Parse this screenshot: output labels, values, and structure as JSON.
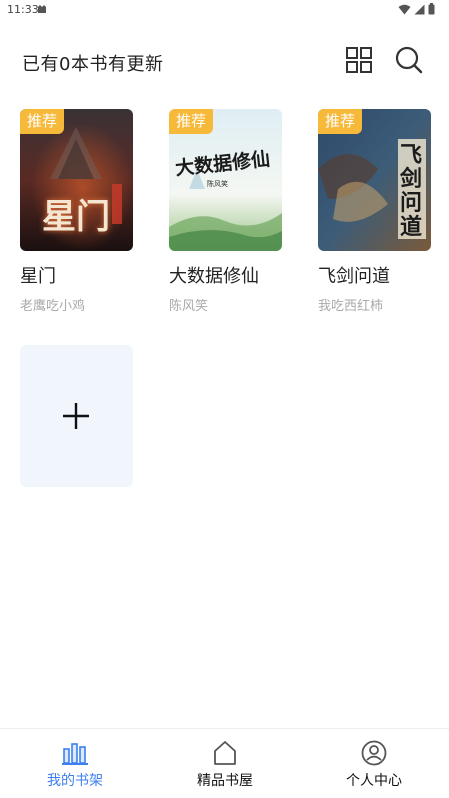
{
  "status_bar": {
    "time": "11:33"
  },
  "header": {
    "title": "已有0本书有更新"
  },
  "books": [
    {
      "title": "星门",
      "author": "老鹰吃小鸡",
      "badge": "推荐",
      "cover_text": "星门"
    },
    {
      "title": "大数据修仙",
      "author": "陈风笑",
      "badge": "推荐",
      "cover_text": "大数据修仙"
    },
    {
      "title": "飞剑问道",
      "author": "我吃西红柿",
      "badge": "推荐",
      "cover_text": "飞剑问道"
    }
  ],
  "add_card": {
    "icon": "plus-icon"
  },
  "bottom_nav": {
    "items": [
      {
        "label": "我的书架",
        "icon": "bookshelf-icon",
        "active": true
      },
      {
        "label": "精品书屋",
        "icon": "home-icon",
        "active": false
      },
      {
        "label": "个人中心",
        "icon": "profile-icon",
        "active": false
      }
    ]
  },
  "colors": {
    "accent": "#3d7ff0",
    "badge": "#f7b93a",
    "add_card_bg": "#f1f6fd"
  }
}
